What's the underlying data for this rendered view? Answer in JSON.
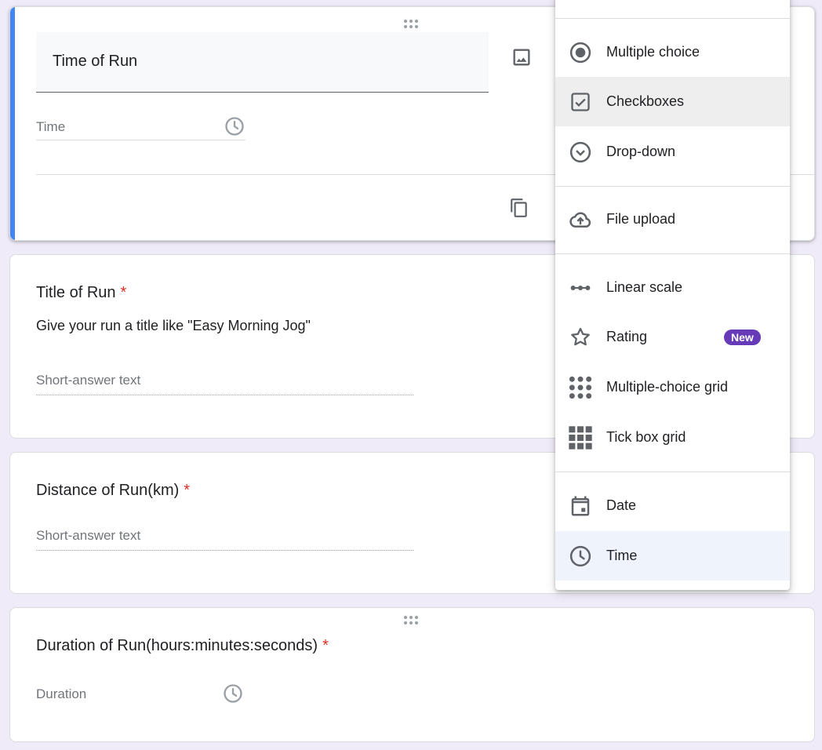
{
  "active_question": {
    "title": "Time of Run",
    "field_placeholder": "Time",
    "icons": {
      "image": "image-icon",
      "clock": "clock-icon",
      "copy": "copy-icon",
      "drag": "drag-handle-icon"
    }
  },
  "questions": [
    {
      "title": "Title of Run",
      "required_mark": "*",
      "description": "Give your run a title like \"Easy Morning Jog\"",
      "answer_placeholder": "Short-answer text"
    },
    {
      "title": "Distance of Run(km)",
      "required_mark": "*",
      "answer_placeholder": "Short-answer text"
    },
    {
      "title": "Duration of Run(hours:minutes:seconds)",
      "required_mark": "*",
      "answer_placeholder": "Duration"
    }
  ],
  "type_menu": {
    "items": [
      {
        "label": "Multiple choice",
        "icon": "radio-icon"
      },
      {
        "label": "Checkboxes",
        "icon": "checkbox-icon",
        "state": "hover"
      },
      {
        "label": "Drop-down",
        "icon": "dropdown-icon"
      },
      {
        "label": "File upload",
        "icon": "cloud-upload-icon"
      },
      {
        "label": "Linear scale",
        "icon": "linear-scale-icon"
      },
      {
        "label": "Rating",
        "icon": "star-icon",
        "badge": "New"
      },
      {
        "label": "Multiple-choice grid",
        "icon": "dot-grid-icon"
      },
      {
        "label": "Tick box grid",
        "icon": "square-grid-icon"
      },
      {
        "label": "Date",
        "icon": "calendar-icon"
      },
      {
        "label": "Time",
        "icon": "clock-icon",
        "state": "selected"
      }
    ]
  },
  "colors": {
    "background": "#f0ebf8",
    "active_accent": "#4285f4",
    "required": "#d93025",
    "badge": "#673ab7",
    "icon": "#5f6368"
  }
}
